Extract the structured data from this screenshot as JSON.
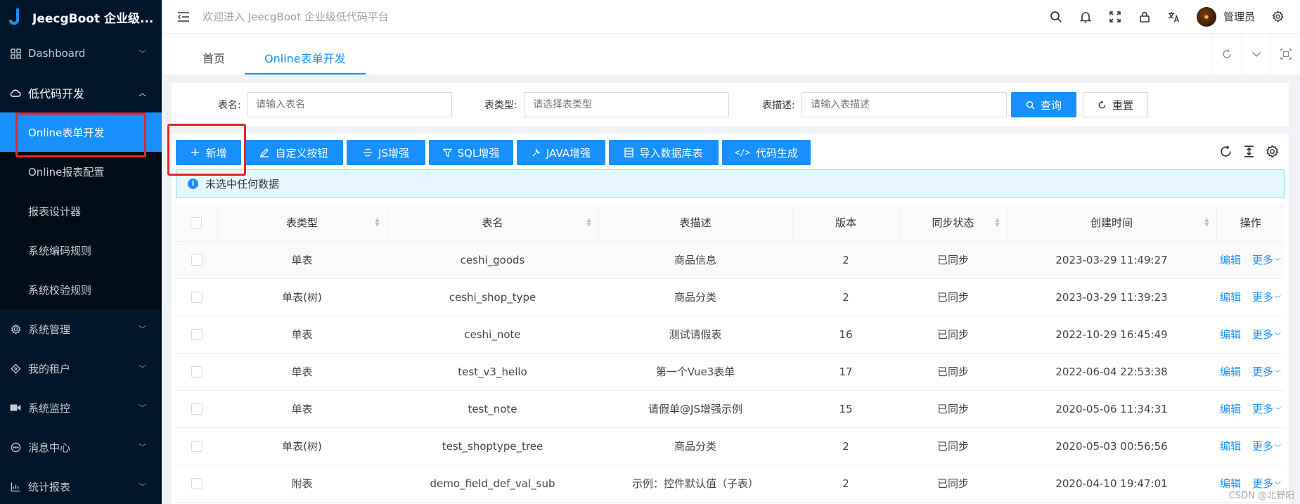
{
  "app": {
    "title": "JeecgBoot 企业级..."
  },
  "sidebar": {
    "menu": [
      {
        "label": "Dashboard",
        "icon": "dashboard-icon"
      },
      {
        "label": "低代码开发",
        "icon": "cloud-icon",
        "open": true,
        "children": [
          "Online表单开发",
          "Online报表配置",
          "报表设计器",
          "系统编码规则",
          "系统校验规则"
        ]
      },
      {
        "label": "系统管理",
        "icon": "gear-icon"
      },
      {
        "label": "我的租户",
        "icon": "diamond-icon"
      },
      {
        "label": "系统监控",
        "icon": "video-icon"
      },
      {
        "label": "消息中心",
        "icon": "message-icon"
      },
      {
        "label": "统计报表",
        "icon": "chart-icon"
      }
    ],
    "active_child": "Online表单开发"
  },
  "header": {
    "welcome": "欢迎进入 JeecgBoot 企业级低代码平台",
    "username": "管理员"
  },
  "tabs": [
    {
      "label": "首页",
      "active": false
    },
    {
      "label": "Online表单开发",
      "active": true
    }
  ],
  "search": {
    "table_name_label": "表名:",
    "table_name_placeholder": "请输入表名",
    "table_type_label": "表类型:",
    "table_type_placeholder": "请选择表类型",
    "table_desc_label": "表描述:",
    "table_desc_placeholder": "请输入表描述",
    "query_label": "查询",
    "reset_label": "重置"
  },
  "toolbar": {
    "add_label": "新增",
    "custom_button_label": "自定义按钮",
    "js_label": "JS增强",
    "sql_label": "SQL增强",
    "java_label": "JAVA增强",
    "import_label": "导入数据库表",
    "codegen_label": "代码生成"
  },
  "alert": {
    "text": "未选中任何数据"
  },
  "table": {
    "columns": [
      "表类型",
      "表名",
      "表描述",
      "版本",
      "同步状态",
      "创建时间",
      "操作"
    ],
    "edit_label": "编辑",
    "more_label": "更多",
    "rows": [
      [
        "单表",
        "ceshi_goods",
        "商品信息",
        "2",
        "已同步",
        "2023-03-29 11:49:27"
      ],
      [
        "单表(树)",
        "ceshi_shop_type",
        "商品分类",
        "2",
        "已同步",
        "2023-03-29 11:39:23"
      ],
      [
        "单表",
        "ceshi_note",
        "测试请假表",
        "16",
        "已同步",
        "2022-10-29 16:45:49"
      ],
      [
        "单表",
        "test_v3_hello",
        "第一个Vue3表单",
        "17",
        "已同步",
        "2022-06-04 22:53:38"
      ],
      [
        "单表",
        "test_note",
        "请假单@JS增强示例",
        "15",
        "已同步",
        "2020-05-06 11:34:31"
      ],
      [
        "单表(树)",
        "test_shoptype_tree",
        "商品分类",
        "2",
        "已同步",
        "2020-05-03 00:56:56"
      ],
      [
        "附表",
        "demo_field_def_val_sub",
        "示例：控件默认值（子表）",
        "2",
        "已同步",
        "2020-04-10 19:47:01"
      ]
    ]
  },
  "watermark": "CSDN @北野阳",
  "colors": {
    "primary": "#1890ff",
    "sidebar": "#001529",
    "success": "#52c41a",
    "highlight": "#e3262a"
  }
}
